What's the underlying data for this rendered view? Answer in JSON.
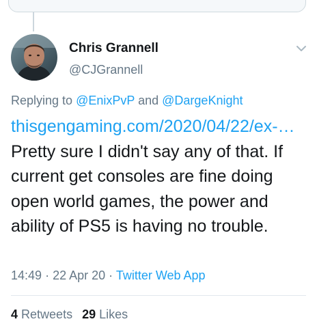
{
  "author": {
    "display_name": "Chris Grannell",
    "handle": "@CJGrannell"
  },
  "reply": {
    "prefix": "Replying to",
    "mention_1": "@EnixPvP",
    "conjunction": "and",
    "mention_2": "@DargeKnight"
  },
  "tweet": {
    "link_text": "thisgengaming.com/2020/04/22/ex-…",
    "text": "Pretty sure I didn't say any of that. If current get consoles are fine doing open world games, the power and ability of PS5 is having no trouble."
  },
  "meta": {
    "time": "14:49",
    "separator": "·",
    "date": "22 Apr 20",
    "app": "Twitter Web App"
  },
  "stats": {
    "retweets_count": "4",
    "retweets_label": "Retweets",
    "likes_count": "29",
    "likes_label": "Likes"
  },
  "icons": {
    "more_menu": "chevron-down-icon"
  },
  "colors": {
    "link": "#1da1f2",
    "secondary_text": "#657786",
    "primary_text": "#14171a"
  }
}
